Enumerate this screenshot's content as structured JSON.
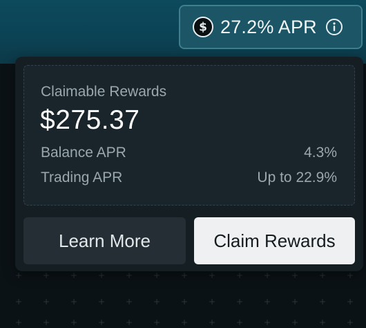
{
  "header": {
    "apr_value": "27.2% APR",
    "currency_icon": "dollar-circle-icon",
    "info_icon": "info-icon"
  },
  "rewards": {
    "claimable_label": "Claimable Rewards",
    "claimable_amount": "$275.37",
    "rows": [
      {
        "label": "Balance APR",
        "value": "4.3%"
      },
      {
        "label": "Trading APR",
        "value": "Up to 22.9%"
      }
    ]
  },
  "actions": {
    "learn_more_label": "Learn More",
    "claim_rewards_label": "Claim Rewards"
  },
  "colors": {
    "header_background": "#0b4254",
    "pill_background": "#1b5566",
    "popover_background": "#151e23",
    "primary_button": "#eef0f1",
    "secondary_button": "#242e34"
  }
}
